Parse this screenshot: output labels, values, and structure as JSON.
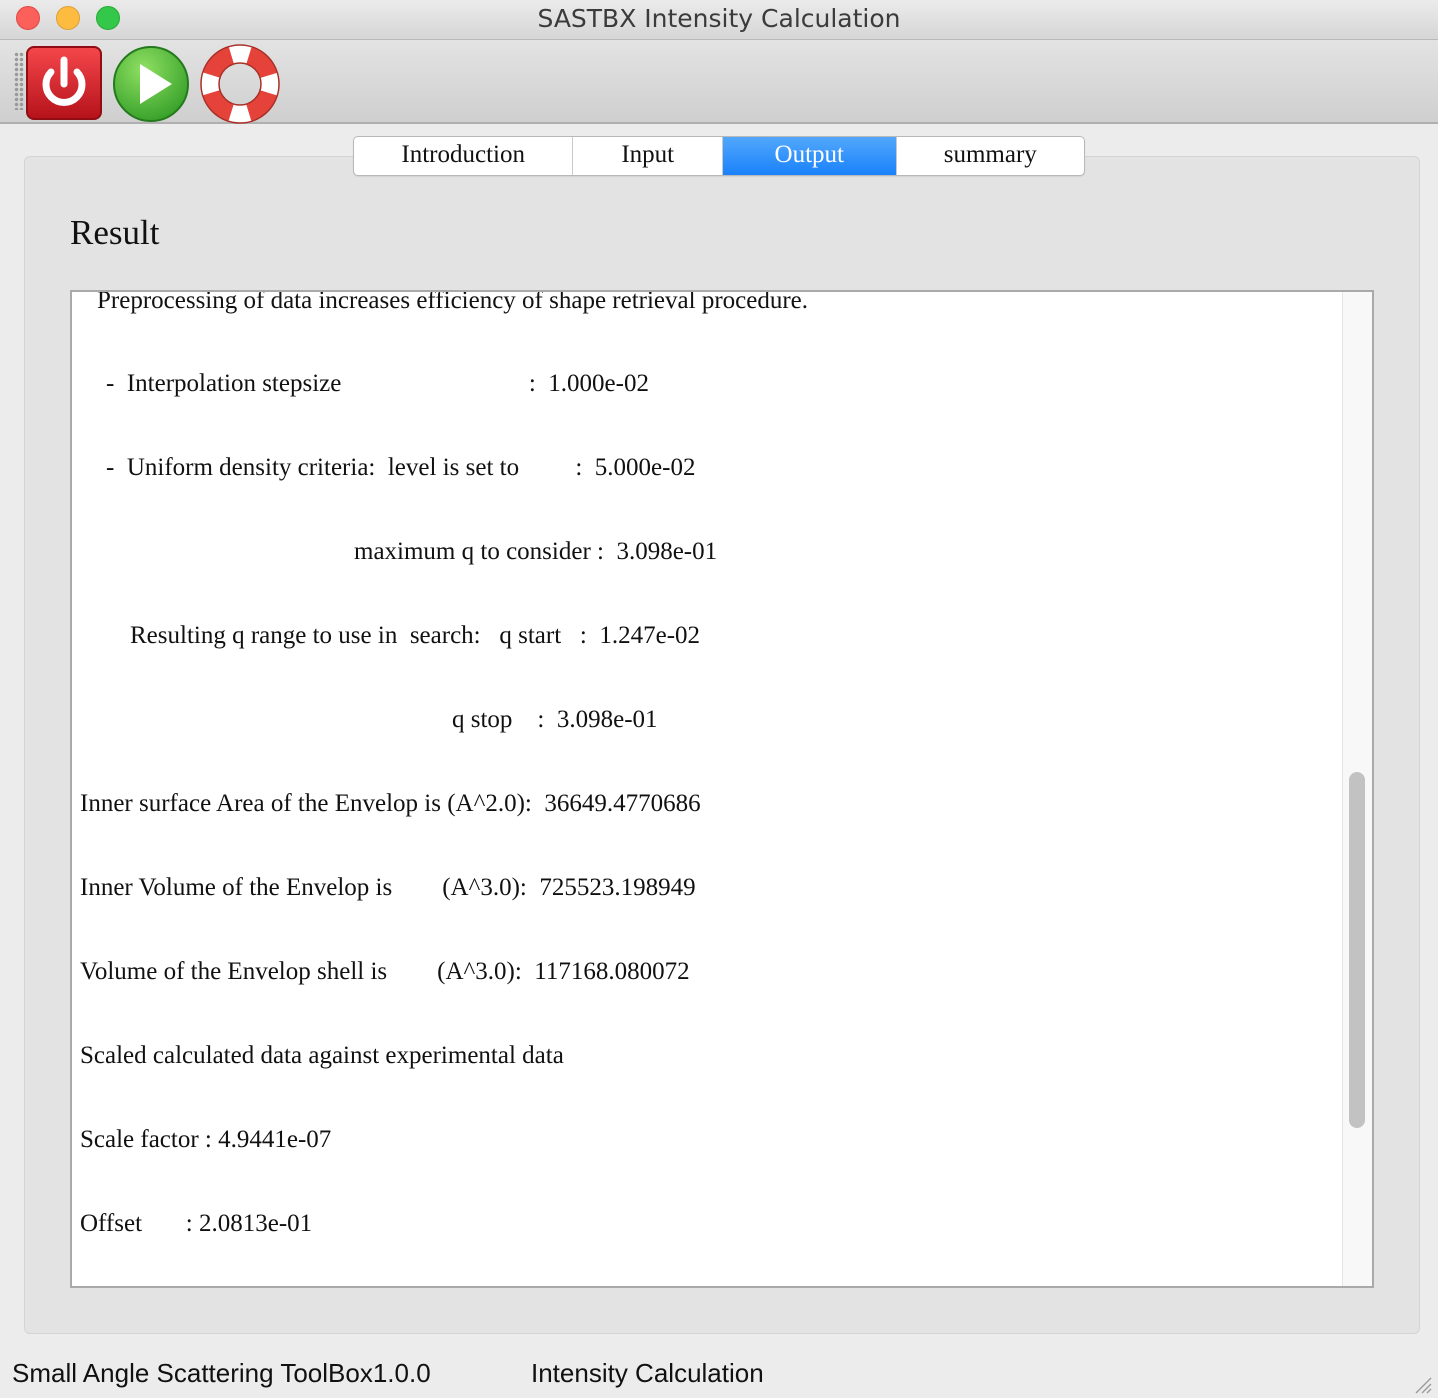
{
  "window": {
    "title": "SASTBX Intensity Calculation"
  },
  "toolbar": {
    "buttons": [
      {
        "icon": "power-icon",
        "color": "#d9262c"
      },
      {
        "icon": "play-icon",
        "color": "#39b54a"
      },
      {
        "icon": "lifebuoy-icon",
        "color": "#e5423a"
      }
    ]
  },
  "tabs": {
    "items": [
      "Introduction",
      "Input",
      "Output",
      "summary"
    ],
    "active": "Output",
    "active_color": "#1a82fb"
  },
  "result": {
    "heading": "Result",
    "lines": {
      "l0": "Preprocessing of data increases efficiency of shape retrieval procedure.",
      "l1": "-  Interpolation stepsize                              :  1.000e-02",
      "l2": "-  Uniform density criteria:  level is set to         :  5.000e-02",
      "l3": "maximum q to consider :  3.098e-01",
      "l4": "Resulting q range to use in  search:   q start   :  1.247e-02",
      "l5": "q stop    :  3.098e-01",
      "l6": "Inner surface Area of the Envelop is (A^2.0):  36649.4770686",
      "l7": "Inner Volume of the Envelop is        (A^3.0):  725523.198949",
      "l8": "Volume of the Envelop shell is        (A^3.0):  117168.080072",
      "l9": "Scaled calculated data against experimental data",
      "l10": "Scale factor : 4.9441e-07",
      "l11": "Offset       : 2.0813e-01"
    }
  },
  "statusbar": {
    "app": "Small Angle Scattering ToolBox1.0.0",
    "module": "Intensity Calculation"
  }
}
